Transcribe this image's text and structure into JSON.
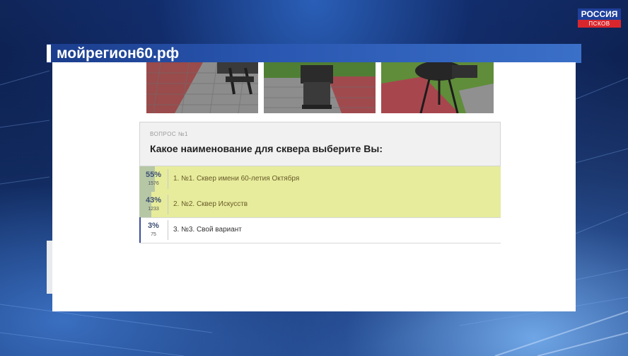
{
  "channel": {
    "name": "РОССИЯ",
    "region": "ПСКОВ"
  },
  "site": {
    "title": "мойрегион60.рф"
  },
  "poll": {
    "question_number": "ВОПРОС №1",
    "question": "Какое наименование для сквера выберите Вы:",
    "options": [
      {
        "percent_label": "55%",
        "percent": 55,
        "count": "1576",
        "label": "1. №1. Сквер имени 60-летия Октября",
        "highlighted": true
      },
      {
        "percent_label": "43%",
        "percent": 43,
        "count": "1233",
        "label": "2. №2. Сквер Искусств",
        "highlighted": true
      },
      {
        "percent_label": "3%",
        "percent": 3,
        "count": "75",
        "label": "3. №3. Свой вариант",
        "highlighted": false
      }
    ]
  },
  "colors": {
    "poll_highlight": "#e6ec9c",
    "percent_text": "#3d4f73",
    "logo_blue": "#1f3f9a",
    "logo_red": "#d9262c"
  }
}
